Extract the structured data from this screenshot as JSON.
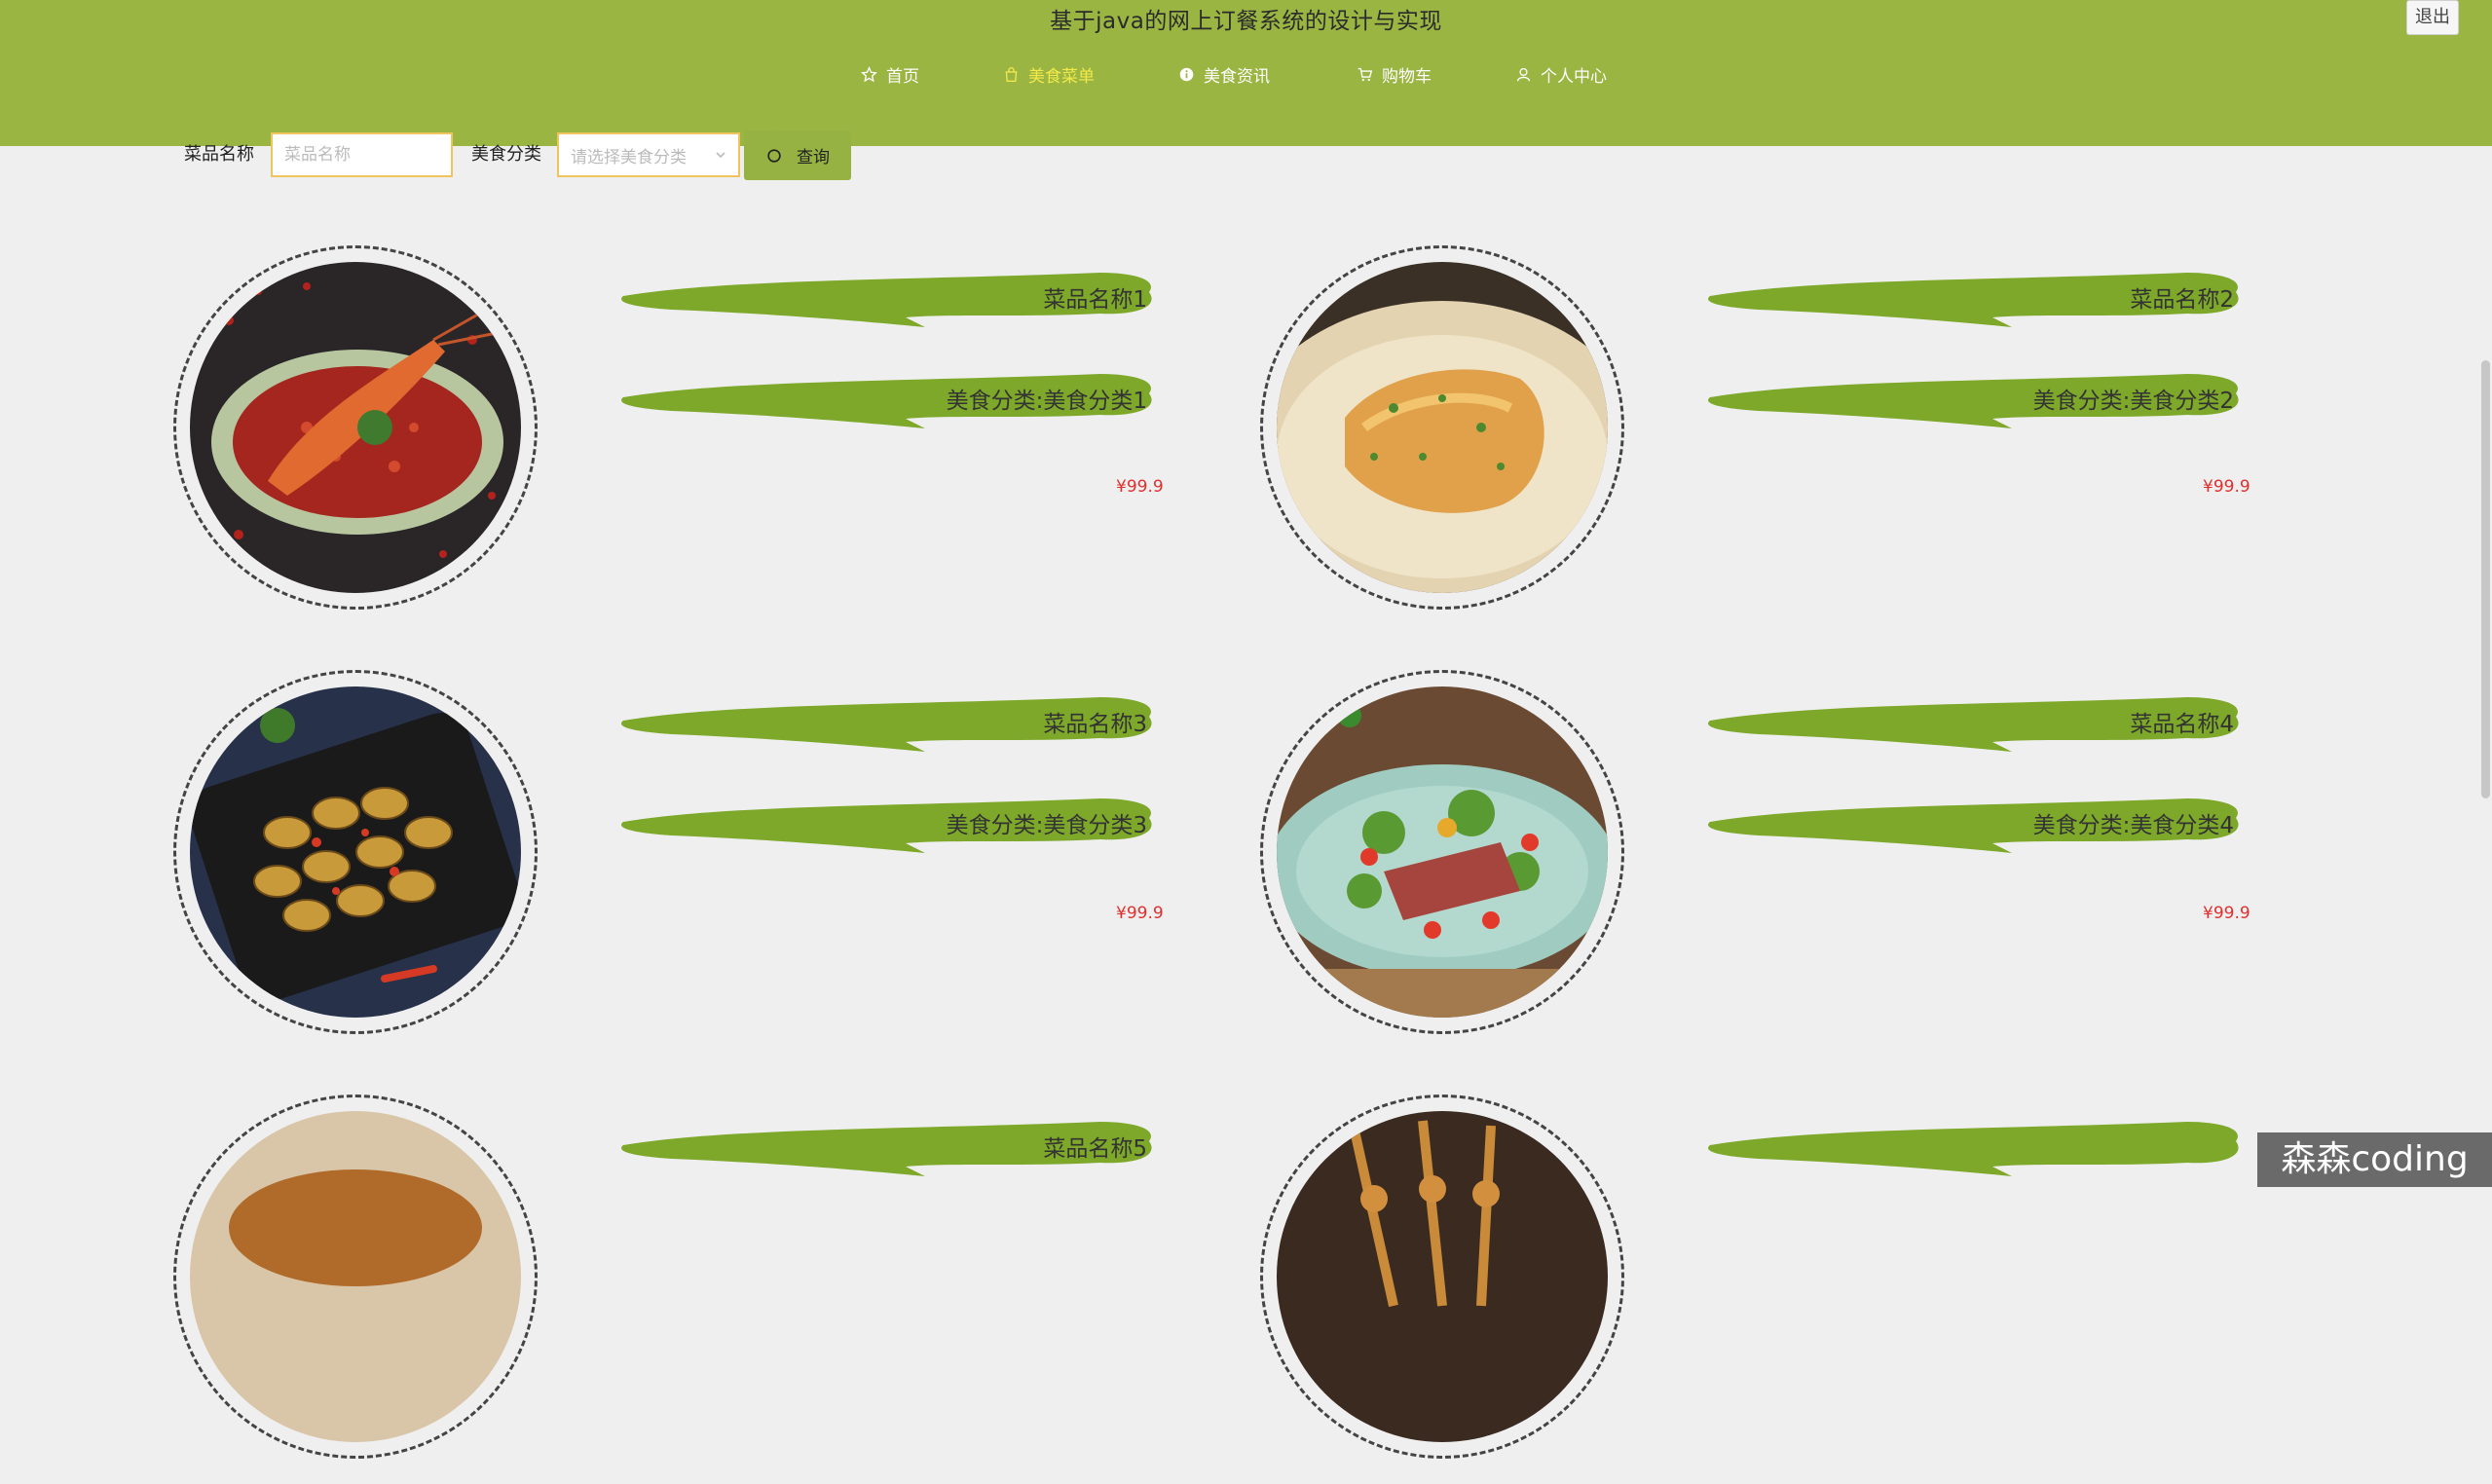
{
  "header": {
    "title": "基于java的网上订餐系统的设计与实现",
    "logout_label": "退出",
    "nav": [
      {
        "label": "首页",
        "icon": "home-icon",
        "active": false
      },
      {
        "label": "美食菜单",
        "icon": "shopping-bag-icon",
        "active": true
      },
      {
        "label": "美食资讯",
        "icon": "info-icon",
        "active": false
      },
      {
        "label": "购物车",
        "icon": "cart-icon",
        "active": false
      },
      {
        "label": "个人中心",
        "icon": "user-icon",
        "active": false
      }
    ]
  },
  "search": {
    "name_label": "菜品名称",
    "name_placeholder": "菜品名称",
    "category_label": "美食分类",
    "category_placeholder": "请选择美食分类",
    "button_label": "查询"
  },
  "foods": [
    {
      "name": "菜品名称1",
      "category": "美食分类:美食分类1",
      "price": "¥99.9",
      "photo": "crayfish-chili-dish"
    },
    {
      "name": "菜品名称2",
      "category": "美食分类:美食分类2",
      "price": "¥99.9",
      "photo": "baked-fish-fillet"
    },
    {
      "name": "菜品名称3",
      "category": "美食分类:美食分类3",
      "price": "¥99.9",
      "photo": "stir-fried-clams"
    },
    {
      "name": "菜品名称4",
      "category": "美食分类:美食分类4",
      "price": "¥99.9",
      "photo": "steak-salad"
    },
    {
      "name": "菜品名称5",
      "category": "",
      "price": "",
      "photo": "soup-bowl"
    },
    {
      "name": "",
      "category": "",
      "price": "",
      "photo": "skewers"
    }
  ],
  "watermark": "森森coding",
  "colors": {
    "header_green": "#9ab542",
    "brush_green": "#7da82a",
    "active_nav": "#f3e94a",
    "input_border": "#f1c35d",
    "price_red": "#e0302e",
    "page_bg": "#efefef"
  }
}
